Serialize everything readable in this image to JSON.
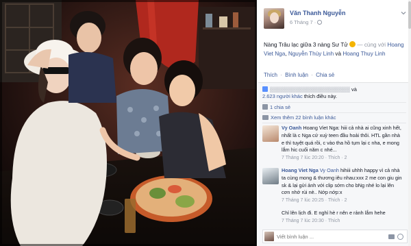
{
  "post": {
    "author": "Văn Thanh Nguyễn",
    "date": "6 Tháng 7 ·",
    "status_text": "Nàng Trâu lạc giữa 3 nàng Sư Tử",
    "with_text": " — cùng với",
    "tag_1": "Hoang Viet Nga",
    "tag_2": "Nguyễn Thùy Linh",
    "and_text": " và ",
    "tag_3": "Hoang Thuy Linh",
    "comma": ", "
  },
  "actions": {
    "like": "Thích",
    "comment": "Bình luận",
    "share": "Chia sẻ",
    "dot": "·"
  },
  "ufi": {
    "likes_prefix": "và",
    "likes_count": "2.623 người khác",
    "likes_suffix": "thích điều này.",
    "shares": "1 chia sẻ",
    "more_comments": "Xem thêm 22 bình luận khác"
  },
  "comments": [
    {
      "author": "Vy Oanh",
      "text": "Hoang Viet Nga: hiii cả nhà ai cũng xinh hết, nhất là c Nga cứ xuỳ teen đầu hoải thôi. HTL gần nhà e thì tuyệt quá rồi, c vào tha hồ tụm lại c nha, e mong lắm hic cuối năm c nhé...",
      "time": "7 Tháng 7 lúc 20:20 · Thích · 2"
    },
    {
      "author": "Hoang Viet Nga",
      "mention": "Vy Oanh",
      "text": "hihiii uhhh happy vì cả nhà ta cùng mong & thương iêu nhau:xxx 2 me con giu gin sk & lại gửi ảnh với clip sớm cho bNg nhé lo lại lên cơn nhớ rùi nè.. Nớp nớp:x",
      "time": "7 Tháng 7 lúc 20:25 · Thích · 2"
    },
    {
      "author": "",
      "text": "Chỉ lên lịch đi. E nghỉ hè r nên e rảnh lắm hehe",
      "time": "7 Tháng 7 lúc 20:30 · Thích"
    }
  ],
  "reply": {
    "placeholder": "Viết bình luận ..."
  }
}
